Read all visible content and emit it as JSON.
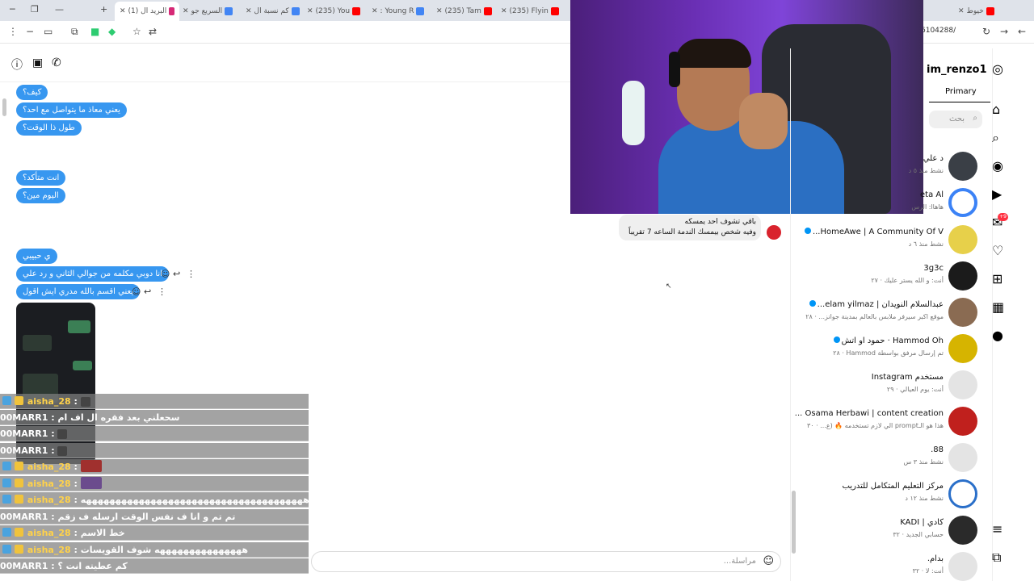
{
  "browser": {
    "tabs": [
      {
        "label": "(1) البريد ال",
        "active": true
      },
      {
        "label": "السريع جو"
      },
      {
        "label": "كم نسبة ال"
      },
      {
        "label": "(235) You"
      },
      {
        "label": ": Young R"
      },
      {
        "label": "(235) Tam"
      },
      {
        "label": "(235) Flyin"
      },
      {
        "label": "خيوط"
      }
    ],
    "url_fragment": "6104288/"
  },
  "chat": {
    "messages": [
      {
        "text": "كيف؟"
      },
      {
        "text": "يعني معاذ ما يتواصل مع احد؟"
      },
      {
        "text": "طول ذا الوقت؟"
      },
      {
        "text": "انت متأكد؟"
      },
      {
        "text": "اليوم مين؟"
      },
      {
        "text": "ي حبيبي"
      },
      {
        "text": "انا دوبي مكلمه من جوالي الثاني و رد علي"
      },
      {
        "text": "يعني اقسم بالله مدري ايش اقول"
      }
    ],
    "shared_message": {
      "line1": "باقي تشوف احد يمسكه",
      "line2": "وفيه شخص بيمسك الندمة الساعه 7 تقريباً"
    },
    "composer_placeholder": "مراسلة..."
  },
  "stream_overlay": [
    {
      "user": "aisha_28",
      "text": ""
    },
    {
      "user": "00MARR1",
      "text": "سحعلني بعد فقره ال اف ام"
    },
    {
      "user": "00MARR1",
      "text": ""
    },
    {
      "user": "00MARR1",
      "text": ""
    },
    {
      "user": "aisha_28",
      "text": ""
    },
    {
      "user": "aisha_28",
      "text": ""
    },
    {
      "user": "aisha_28",
      "text": "ههههههههههههههههههههههههههههههههههههههه"
    },
    {
      "user": "00MARR1",
      "text": "تم تم و انا ف نفس الوقت ارسله ف زقم"
    },
    {
      "user": "aisha_28",
      "text": "خط الاسم"
    },
    {
      "user": "aisha_28",
      "text": "هههههههههههههههه شوف القويسات"
    },
    {
      "user": "00MARR1",
      "text": "كم عطيته انت ؟"
    }
  ],
  "inbox": {
    "username": "im_renzo1",
    "tab": "Primary",
    "search_placeholder": "بحث",
    "conversations": [
      {
        "name": "د علي",
        "sub": "نشط منذ ٥ د"
      },
      {
        "name": "eta Al",
        "sub": "هاهاا: الرس"
      },
      {
        "name": "HomeAwe | A Community Of V...",
        "sub": "نشط منذ ٦ د",
        "verified": true
      },
      {
        "name": "3g3c",
        "sub": "أنت: و الله يستر عليك · ٢٧"
      },
      {
        "name": "عبدالسلام النويدان | elam yilmaz...",
        "sub": "موقع اكبر سيرفر ملابس بالعالم بمدينة جوانز... · ٢٨",
        "verified": true
      },
      {
        "name": "Hammod Oh · حمود او اتش",
        "sub": "تم إرسال مرفق بواسطة Hammod · ٢٨",
        "verified": true
      },
      {
        "name": "مستخدم Instagram",
        "sub": "أنت: يوم العيالي · ٢٩"
      },
      {
        "name": "Osama Herbawi | content creation ...",
        "sub": "هذا هو الـprompt الي لازم تستخدمه 🔥 (ع... · ٣٠"
      },
      {
        "name": "88.",
        "sub": "نشط منذ ٣ س"
      },
      {
        "name": "مركز التعليم المتكامل للتدريب",
        "sub": "نشط منذ ١٢ د"
      },
      {
        "name": "كادي | KADI",
        "sub": "حسابي الجديد · ٣٢"
      },
      {
        "name": "بدام.",
        "sub": "أنت: لا · ٣٢"
      }
    ]
  },
  "rail": {
    "notifications_badge": "+9"
  }
}
